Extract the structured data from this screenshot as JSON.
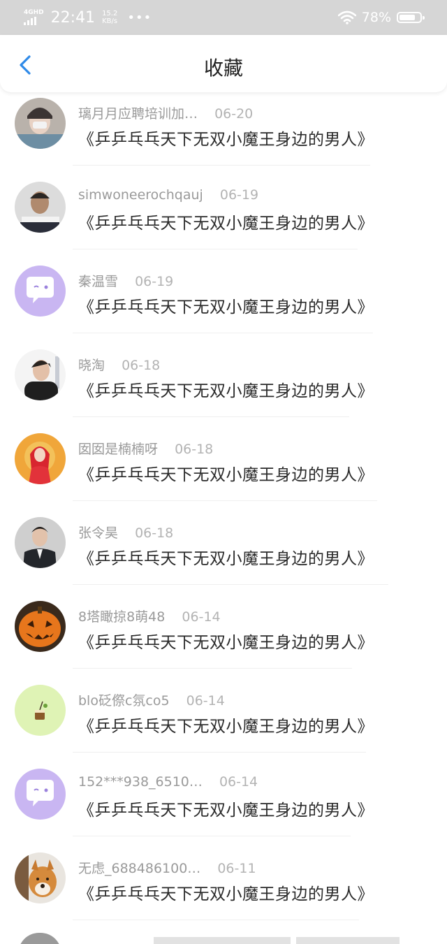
{
  "status_bar": {
    "network": "4GHD",
    "time": "22:41",
    "speed_value": "15.2",
    "speed_unit": "KB/s",
    "more": "•••",
    "battery_percent": "78%",
    "battery_level": 0.78
  },
  "header": {
    "back_icon": "chevron-left-icon",
    "title": "收藏",
    "accent_color": "#2f8ae8"
  },
  "items": [
    {
      "name": "璃月月应聘培训加…",
      "date": "06-20",
      "title": "《乒乒乓乓天下无双小魔王身边的男人》"
    },
    {
      "name": "simwoneerochqauj",
      "date": "06-19",
      "title": "《乒乒乓乓天下无双小魔王身边的男人》"
    },
    {
      "name": "秦温雪",
      "date": "06-19",
      "title": "《乒乒乓乓天下无双小魔王身边的男人》"
    },
    {
      "name": "晓淘",
      "date": "06-18",
      "title": "《乒乒乓乓天下无双小魔王身边的男人》"
    },
    {
      "name": "囡囡是楠楠呀",
      "date": "06-18",
      "title": "《乒乒乓乓天下无双小魔王身边的男人》"
    },
    {
      "name": "张令昊",
      "date": "06-18",
      "title": "《乒乒乓乓天下无双小魔王身边的男人》"
    },
    {
      "name": "8塔瞰掠8萌48",
      "date": "06-14",
      "title": "《乒乒乓乓天下无双小魔王身边的男人》"
    },
    {
      "name": "blo砭傺c氛co5",
      "date": "06-14",
      "title": "《乒乒乓乓天下无双小魔王身边的男人》"
    },
    {
      "name": "152***938_6510…",
      "date": "06-14",
      "title": "《乒乒乓乓天下无双小魔王身边的男人》"
    },
    {
      "name": "无虑_688486100…",
      "date": "06-11",
      "title": "《乒乒乓乓天下无双小魔王身边的男人》"
    }
  ]
}
